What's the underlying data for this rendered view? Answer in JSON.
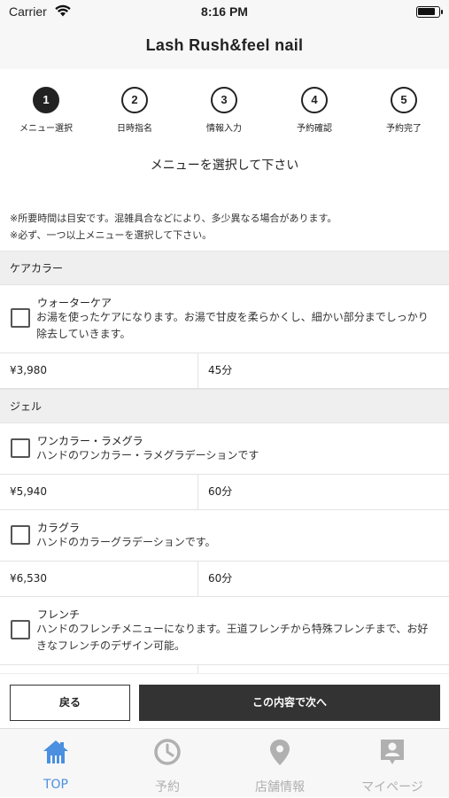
{
  "status": {
    "carrier": "Carrier",
    "time": "8:16 PM"
  },
  "header": {
    "title": "Lash Rush&feel nail"
  },
  "steps": [
    {
      "num": "1",
      "label": "メニュー選択"
    },
    {
      "num": "2",
      "label": "日時指名"
    },
    {
      "num": "3",
      "label": "情報入力"
    },
    {
      "num": "4",
      "label": "予約確認"
    },
    {
      "num": "5",
      "label": "予約完了"
    }
  ],
  "main": {
    "heading": "メニューを選択して下さい",
    "note1": "※所要時間は目安です。混雑具合などにより、多少異なる場合があります。",
    "note2": "※必ず、一つ以上メニューを選択して下さい。"
  },
  "categories": [
    {
      "name": "ケアカラー",
      "items": [
        {
          "name": "ウォーターケア",
          "desc": "お湯を使ったケアになります。お湯で甘皮を柔らかくし、細かい部分までしっかり除去していきます。",
          "price": "¥3,980",
          "duration": "45分"
        }
      ]
    },
    {
      "name": "ジェル",
      "items": [
        {
          "name": "ワンカラー・ラメグラ",
          "desc": "ハンドのワンカラー・ラメグラデーションです",
          "price": "¥5,940",
          "duration": "60分"
        },
        {
          "name": "カラグラ",
          "desc": "ハンドのカラーグラデーションです。",
          "price": "¥6,530",
          "duration": "60分"
        },
        {
          "name": "フレンチ",
          "desc": "ハンドのフレンチメニューになります。王道フレンチから特殊フレンチまで、お好きなフレンチのデザイン可能。",
          "price": "",
          "duration": ""
        }
      ]
    }
  ],
  "actions": {
    "back_label": "戻る",
    "next_label": "この内容で次へ"
  },
  "tabbar": [
    {
      "label": "TOP",
      "icon": "home-icon",
      "active": true
    },
    {
      "label": "予約",
      "icon": "clock-icon"
    },
    {
      "label": "店舗情報",
      "icon": "map-pin-icon"
    },
    {
      "label": "マイページ",
      "icon": "profile-badge-icon"
    }
  ],
  "colors": {
    "accent": "#4a8fe0",
    "inactive": "#b0b0b0",
    "primary_button": "#333333"
  }
}
